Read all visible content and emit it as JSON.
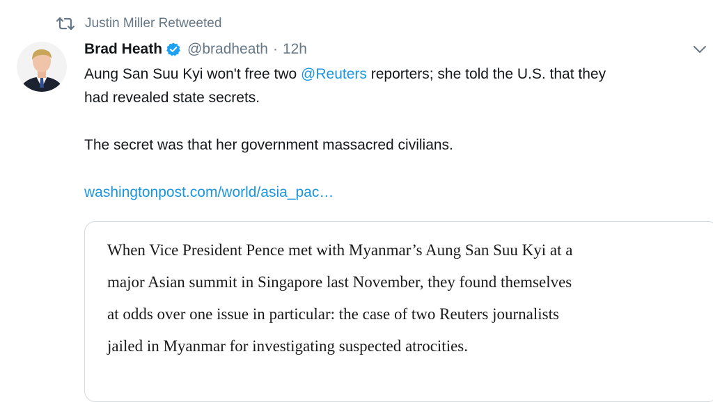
{
  "retweet": {
    "icon": "retweet-icon",
    "text": "Justin Miller Retweeted"
  },
  "tweet": {
    "avatar_icon": "avatar",
    "author_name": "Brad Heath",
    "verified_icon": "verified-badge-icon",
    "handle": "@bradheath",
    "separator": "·",
    "time": "12h",
    "caret_icon": "chevron-down-icon",
    "text": {
      "line1_pre": "Aung San Suu Kyi won't free two ",
      "mention": "@Reuters",
      "line1_post": " reporters; she told the U.S. that they",
      "line2": "had revealed state secrets.",
      "paragraph2": "The secret was that her government massacred civilians.",
      "link": "washingtonpost.com/world/asia_pac…"
    }
  },
  "card": {
    "quote_lines": [
      "When Vice President Pence met with Myanmar’s Aung San Suu Kyi at a",
      "major Asian summit in Singapore last November, they found themselves",
      "at odds over one issue in particular: the case of two Reuters journalists",
      "jailed in Myanmar for investigating suspected atrocities."
    ]
  },
  "colors": {
    "text": "#14171a",
    "secondary": "#657786",
    "link": "#1b95e0",
    "border": "#d4d9dd"
  }
}
